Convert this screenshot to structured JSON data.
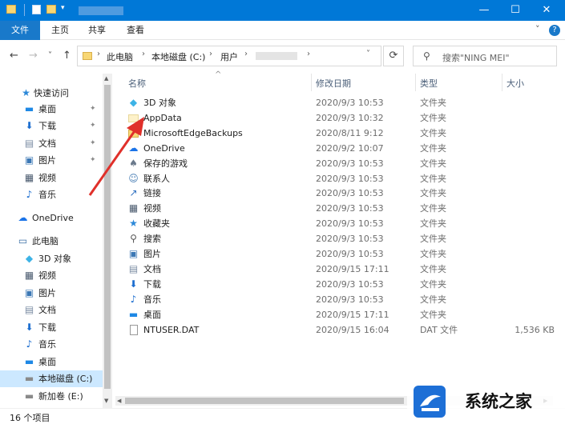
{
  "window": {
    "minimize": "—",
    "maximize": "☐",
    "close": "✕"
  },
  "ribbon": {
    "tabs": [
      "文件",
      "主页",
      "共享",
      "查看"
    ],
    "help": "?",
    "collapse": "˅"
  },
  "nav_buttons": {
    "back": "←",
    "forward": "→",
    "recent": "˅",
    "up": "↑"
  },
  "address": {
    "crumbs": [
      "此电脑",
      "本地磁盘 (C:)",
      "用户"
    ],
    "refresh": "⟳"
  },
  "search": {
    "placeholder": "搜索\"NING MEI\""
  },
  "sidebar": {
    "items": [
      {
        "label": "快速访问",
        "icon": "star-icon",
        "pinned": false
      },
      {
        "label": "桌面",
        "icon": "desktop-icon",
        "pinned": true
      },
      {
        "label": "下载",
        "icon": "download-icon",
        "pinned": true
      },
      {
        "label": "文档",
        "icon": "document-icon",
        "pinned": true
      },
      {
        "label": "图片",
        "icon": "picture-icon",
        "pinned": true
      },
      {
        "label": "视频",
        "icon": "video-icon",
        "pinned": false
      },
      {
        "label": "音乐",
        "icon": "music-icon",
        "pinned": false
      },
      {
        "label": "OneDrive",
        "icon": "cloud-icon",
        "pinned": false
      },
      {
        "label": "此电脑",
        "icon": "computer-icon",
        "pinned": false
      },
      {
        "label": "3D 对象",
        "icon": "cube-icon",
        "pinned": false
      },
      {
        "label": "视频",
        "icon": "video-icon",
        "pinned": false
      },
      {
        "label": "图片",
        "icon": "picture-icon",
        "pinned": false
      },
      {
        "label": "文档",
        "icon": "document-icon",
        "pinned": false
      },
      {
        "label": "下载",
        "icon": "download-icon",
        "pinned": false
      },
      {
        "label": "音乐",
        "icon": "music-icon",
        "pinned": false
      },
      {
        "label": "桌面",
        "icon": "desktop-icon",
        "pinned": false
      },
      {
        "label": "本地磁盘 (C:)",
        "icon": "drive-icon",
        "pinned": false,
        "selected": true
      },
      {
        "label": "新加卷 (E:)",
        "icon": "drive-icon",
        "pinned": false
      }
    ]
  },
  "columns": {
    "name": "名称",
    "date": "修改日期",
    "type": "类型",
    "size": "大小"
  },
  "files": [
    {
      "name": "3D 对象",
      "date": "2020/9/3 10:53",
      "type": "文件夹",
      "size": "",
      "icon": "cube-icon"
    },
    {
      "name": "AppData",
      "date": "2020/9/3 10:32",
      "type": "文件夹",
      "size": "",
      "icon": "appdata-folder-icon"
    },
    {
      "name": "MicrosoftEdgeBackups",
      "date": "2020/8/11 9:12",
      "type": "文件夹",
      "size": "",
      "icon": "folder-icon"
    },
    {
      "name": "OneDrive",
      "date": "2020/9/2 10:07",
      "type": "文件夹",
      "size": "",
      "icon": "cloud-icon"
    },
    {
      "name": "保存的游戏",
      "date": "2020/9/3 10:53",
      "type": "文件夹",
      "size": "",
      "icon": "game-icon"
    },
    {
      "name": "联系人",
      "date": "2020/9/3 10:53",
      "type": "文件夹",
      "size": "",
      "icon": "contacts-icon"
    },
    {
      "name": "链接",
      "date": "2020/9/3 10:53",
      "type": "文件夹",
      "size": "",
      "icon": "link-icon"
    },
    {
      "name": "视频",
      "date": "2020/9/3 10:53",
      "type": "文件夹",
      "size": "",
      "icon": "video-icon"
    },
    {
      "name": "收藏夹",
      "date": "2020/9/3 10:53",
      "type": "文件夹",
      "size": "",
      "icon": "star-icon"
    },
    {
      "name": "搜索",
      "date": "2020/9/3 10:53",
      "type": "文件夹",
      "size": "",
      "icon": "search-icon"
    },
    {
      "name": "图片",
      "date": "2020/9/3 10:53",
      "type": "文件夹",
      "size": "",
      "icon": "picture-icon"
    },
    {
      "name": "文档",
      "date": "2020/9/15 17:11",
      "type": "文件夹",
      "size": "",
      "icon": "document-icon"
    },
    {
      "name": "下载",
      "date": "2020/9/3 10:53",
      "type": "文件夹",
      "size": "",
      "icon": "download-icon"
    },
    {
      "name": "音乐",
      "date": "2020/9/3 10:53",
      "type": "文件夹",
      "size": "",
      "icon": "music-icon"
    },
    {
      "name": "桌面",
      "date": "2020/9/15 17:11",
      "type": "文件夹",
      "size": "",
      "icon": "desktop-icon"
    },
    {
      "name": "NTUSER.DAT",
      "date": "2020/9/15 16:04",
      "type": "DAT 文件",
      "size": "1,536 KB",
      "icon": "file-icon"
    }
  ],
  "status": {
    "count": "16 个项目"
  },
  "watermark": {
    "text": "系统之家"
  },
  "colors": {
    "titlebar": "#0078d7",
    "selection": "#cce8ff",
    "annotation_arrow": "#e0302a"
  }
}
